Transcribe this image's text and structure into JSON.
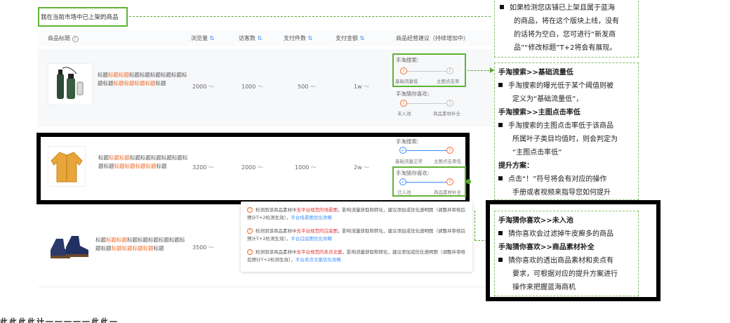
{
  "market_label": "我在当前市场中已上架的商品",
  "headers": {
    "title": "商品标题",
    "views": "浏览量",
    "visitors": "访客数",
    "pay_items": "支付件数",
    "pay_amount": "支付金额",
    "advice": "商品经营建议（持续增加中）"
  },
  "rows": [
    {
      "title_parts": [
        "标题",
        "标题标题",
        "标题标题",
        "标题标题标题标题标题",
        "标题标题标题标题",
        "标题"
      ],
      "views": "2000",
      "visitors": "1000",
      "pay_items": "500",
      "pay_amount": "1w"
    },
    {
      "title_parts": [
        "标题",
        "标题标题",
        "标题标题",
        "标题标题标题标题标题",
        "标题标题标题标题",
        "标题"
      ],
      "views": "3200",
      "visitors": "2000",
      "pay_items": "1000",
      "pay_amount": "2w"
    },
    {
      "title_parts": [
        "标题",
        "标题标题",
        "标题标题",
        "标题标题标题标题标题",
        "标题标题标题标题",
        "标题"
      ],
      "views": "3500"
    }
  ],
  "suggest": {
    "search_title": "手淘搜索:",
    "guess_title": "手淘猜你喜欢:",
    "row1": {
      "s_left": "基础流量低",
      "s_right": "主图点击率",
      "g_left": "未入池",
      "g_right": "商品素材补全"
    },
    "row2": {
      "s_left": "基础流量正常",
      "s_right": "主图点击率低",
      "g_left": "已入池",
      "g_right": "商品素材补全"
    }
  },
  "popup": [
    {
      "pre": "检测到该商品素材中",
      "red": "无平台规范的场景图",
      "mid": "，影响流量获取和转化，建议添加或优化透明图（调整并审核后预计T+2检测生效），",
      "link": "平台场景图优化攻略"
    },
    {
      "pre": "检测到该商品素材中",
      "red": "无平台规范的白底图",
      "mid": "，影响流量获取和转化，建议添加或优化透明图（调整并审核后预计T+2检测生效），",
      "link": "平台白底图优化攻略"
    },
    {
      "pre": "检测到该商品素材中",
      "red": "无平台规范的卖点文案",
      "mid": "，影响流量获取和转化，建议添加或优化透明图（调整并审核后预计T+2检测生效），",
      "link": "平台卖点文案优化攻略"
    }
  ],
  "panel_top": {
    "b1": "如果检测您店铺已上架且属于蓝海",
    "b1_l2": "的商品，将在这个版块上线，没有",
    "b1_l3": "的话将为空白，您可进行“新发商",
    "b1_l4": "品”“修改标题”T+2将会有展现。"
  },
  "panel_mid": {
    "h1": "手淘搜索>>基础流量低",
    "b1_l1": "手淘搜索的曝光低于某个阈值则被",
    "b1_l2": "定义为“基础流量低”，",
    "h2": "手淘搜索>>主图点击率低",
    "b2_l1": "手淘搜索的主图点击率低于该商品",
    "b2_l2": "所属叶子类目均值时，则会判定为",
    "b2_l3": "“主图点击率低”",
    "h3": "提升方案：",
    "b3_l1": "点击“！”符号将会有对应的操作",
    "b3_l2": "手册或者视频来指导您如何提升"
  },
  "panel_bottom": {
    "h1": "手淘猜你喜欢>>未入池",
    "b1": "猜你喜欢会过滤掉牛皮癣多的商品",
    "h2": "手淘猜你喜欢>>商品素材补全",
    "b2_l1": "猜你喜欢的透出商品素材和卖点有",
    "b2_l2": "要求，可根据对应的提升方案进行",
    "b2_l3": "操作来把握蓝海商机"
  },
  "footer_text": "此此此此计一一一一一此此一"
}
